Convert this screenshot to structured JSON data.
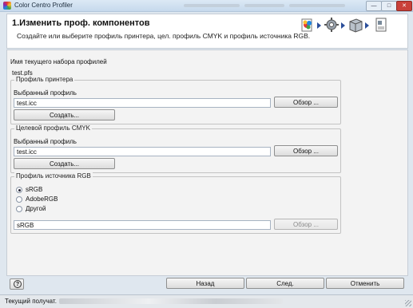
{
  "window": {
    "title": "Color Centro Profiler"
  },
  "header": {
    "step_title": "1.Изменить проф. компонентов",
    "step_description": "Создайте или выберите профиль принтера, цел. профиль CMYK и профиль источника RGB.",
    "wizard_steps": [
      "palette-icon",
      "gear-icon",
      "printer-box-icon",
      "document-icon"
    ]
  },
  "profile_set": {
    "label": "Имя текущего набора профилей",
    "value": "test.pfs"
  },
  "printer_profile": {
    "group_title": "Профиль принтера",
    "selected_label": "Выбранный профиль",
    "value": "test.icc",
    "browse_label": "Обзор ...",
    "create_label": "Создать..."
  },
  "cmyk_profile": {
    "group_title": "Целевой профиль CMYK",
    "selected_label": "Выбранный профиль",
    "value": "test.icc",
    "browse_label": "Обзор ...",
    "create_label": "Создать..."
  },
  "rgb_profile": {
    "group_title": "Профиль источника RGB",
    "options": [
      {
        "label": "sRGB",
        "selected": true
      },
      {
        "label": "AdobeRGB",
        "selected": false
      },
      {
        "label": "Другой",
        "selected": false
      }
    ],
    "value": "sRGB",
    "browse_label": "Обзор ..."
  },
  "footer": {
    "help_label": "?",
    "back_label": "Назад",
    "next_label": "След.",
    "cancel_label": "Отменить"
  },
  "status": {
    "text": "Текущий получат."
  }
}
